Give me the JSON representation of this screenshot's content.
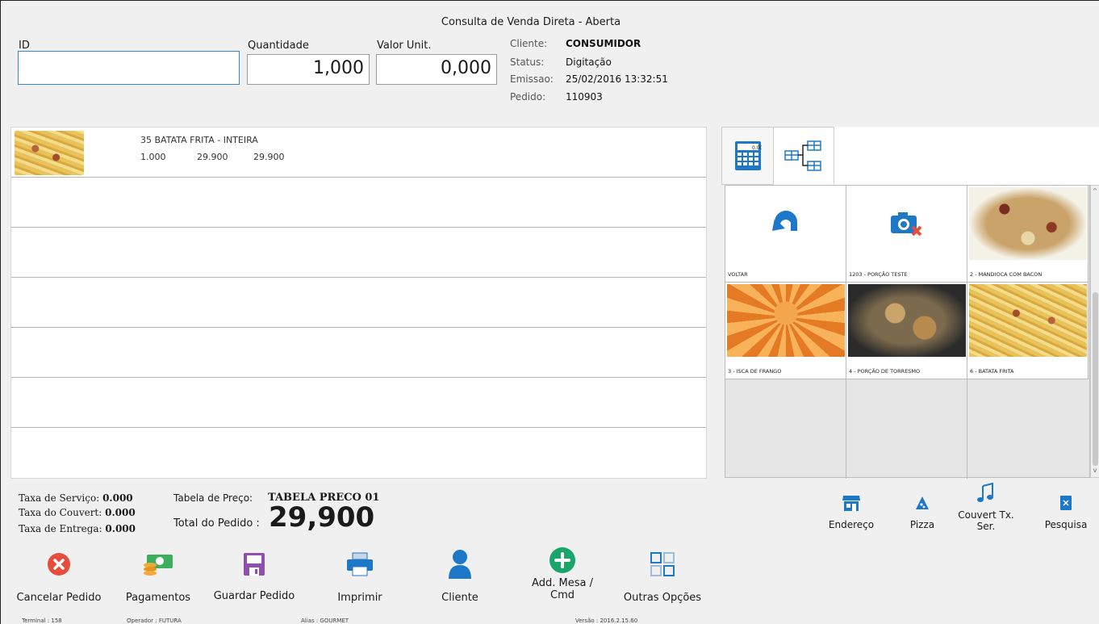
{
  "window": {
    "title": "Consulta de Venda Direta - Aberta"
  },
  "entry": {
    "id_label": "ID",
    "id_value": "",
    "qty_label": "Quantidade",
    "qty_value": "1,000",
    "unit_label": "Valor Unit.",
    "unit_value": "0,000"
  },
  "info": {
    "client_key": "Cliente:",
    "client_val": "CONSUMIDOR",
    "status_key": "Status:",
    "status_val": "Digitação",
    "emissao_key": "Emissao:",
    "emissao_val": "25/02/2016 13:32:51",
    "pedido_key": "Pedido:",
    "pedido_val": "110903"
  },
  "order_items": [
    {
      "name": "35 BATATA FRITA - INTEIRA",
      "qty": "1.000",
      "unit": "29.900",
      "total": "29.900"
    }
  ],
  "products": [
    {
      "caption": "VOLTAR",
      "icon": "undo-icon"
    },
    {
      "caption": "1203 - PORÇÃO TESTE",
      "icon": "no-photo-icon"
    },
    {
      "caption": "2 - MANDIOCA COM BACON"
    },
    {
      "caption": "3 - ISCA DE FRANGO"
    },
    {
      "caption": "4 - PORÇÃO DE TORRESMO"
    },
    {
      "caption": "6 - BATATA FRITA"
    }
  ],
  "totals": {
    "servico_label": "Taxa de Serviço:",
    "servico_val": "0.000",
    "couvert_label": "Taxa do Couvert:",
    "couvert_val": "0.000",
    "entrega_label": "Taxa de Entrega:",
    "entrega_val": "0.000",
    "tabela_label": "Tabela de Preço:",
    "tabela_val": "TABELA PRECO 01",
    "total_label": "Total do Pedido :",
    "total_val": "29,900"
  },
  "mini_toolbar": {
    "endereco": "Endereço",
    "pizza": "Pizza",
    "couvert_line1": "Couvert Tx.",
    "couvert_line2": "Ser.",
    "pesquisa": "Pesquisa"
  },
  "toolbar": {
    "cancelar": "Cancelar Pedido",
    "pagamentos": "Pagamentos",
    "guardar": "Guardar Pedido",
    "imprimir": "Imprimir",
    "cliente": "Cliente",
    "add_line1": "Add. Mesa /",
    "add_line2": "Cmd",
    "outras": "Outras Opções"
  },
  "status": {
    "terminal": "Terminal :  158",
    "operador": "Operador :  FUTURA",
    "alias": "Alias :  GOURMET",
    "versao": "Versão :  2016.2.15.60"
  },
  "colors": {
    "cancel_red": "#e74c3c",
    "add_green": "#1aa56a",
    "accent_blue": "#1e78c8",
    "save_purple": "#8e4fb0",
    "money_green": "#3cae5c"
  }
}
